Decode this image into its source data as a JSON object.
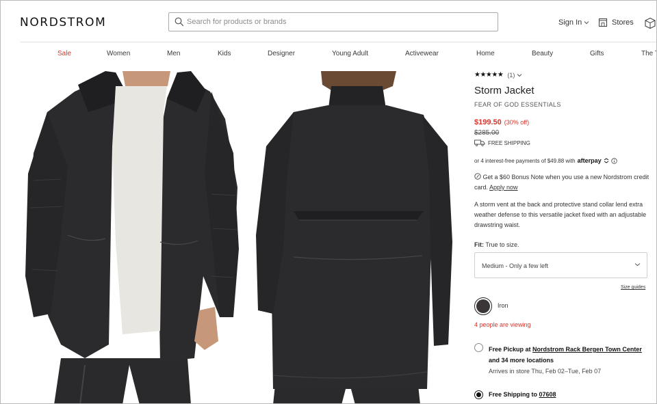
{
  "header": {
    "logo": "NORDSTROM",
    "search_placeholder": "Search for products or brands",
    "sign_in": "Sign In",
    "stores": "Stores"
  },
  "nav": {
    "items": [
      "Sale",
      "Women",
      "Men",
      "Kids",
      "Designer",
      "Young Adult",
      "Activewear",
      "Home",
      "Beauty",
      "Gifts",
      "The T"
    ]
  },
  "product": {
    "rating_stars": "★★★★★",
    "rating_count": "(1)",
    "title": "Storm Jacket",
    "brand": "FEAR OF GOD ESSENTIALS",
    "price": "$199.50",
    "discount": "(30% off)",
    "original_price": "$285.00",
    "shipping": "FREE SHIPPING",
    "installments": "or 4 interest-free payments of $49.88 with",
    "afterpay": "afterpay",
    "bonus_text": "Get a $60 Bonus Note when you use a new Nordstrom credit card.",
    "bonus_link": "Apply now",
    "description": "A storm vent at the back and protective stand collar lend extra weather defense to this versatile jacket fixed with an adjustable drawstring waist.",
    "fit_label": "Fit:",
    "fit_value": "True to size.",
    "size_selected": "Medium - Only a few left",
    "size_guides": "Size guides",
    "color_name": "Iron",
    "color_hex": "#3a3537",
    "viewing": "4 people are viewing",
    "pickup_prefix": "Free Pickup at",
    "pickup_store": "Nordstrom Rack Bergen Town Center",
    "pickup_more": "and 34 more locations",
    "arrives": "Arrives in store Thu, Feb 02–Tue, Feb 07",
    "ship_prefix": "Free Shipping to",
    "ship_zip": "07608"
  },
  "colors": {
    "sale_red": "#d5352a",
    "jacket": "#2b2b2e"
  }
}
